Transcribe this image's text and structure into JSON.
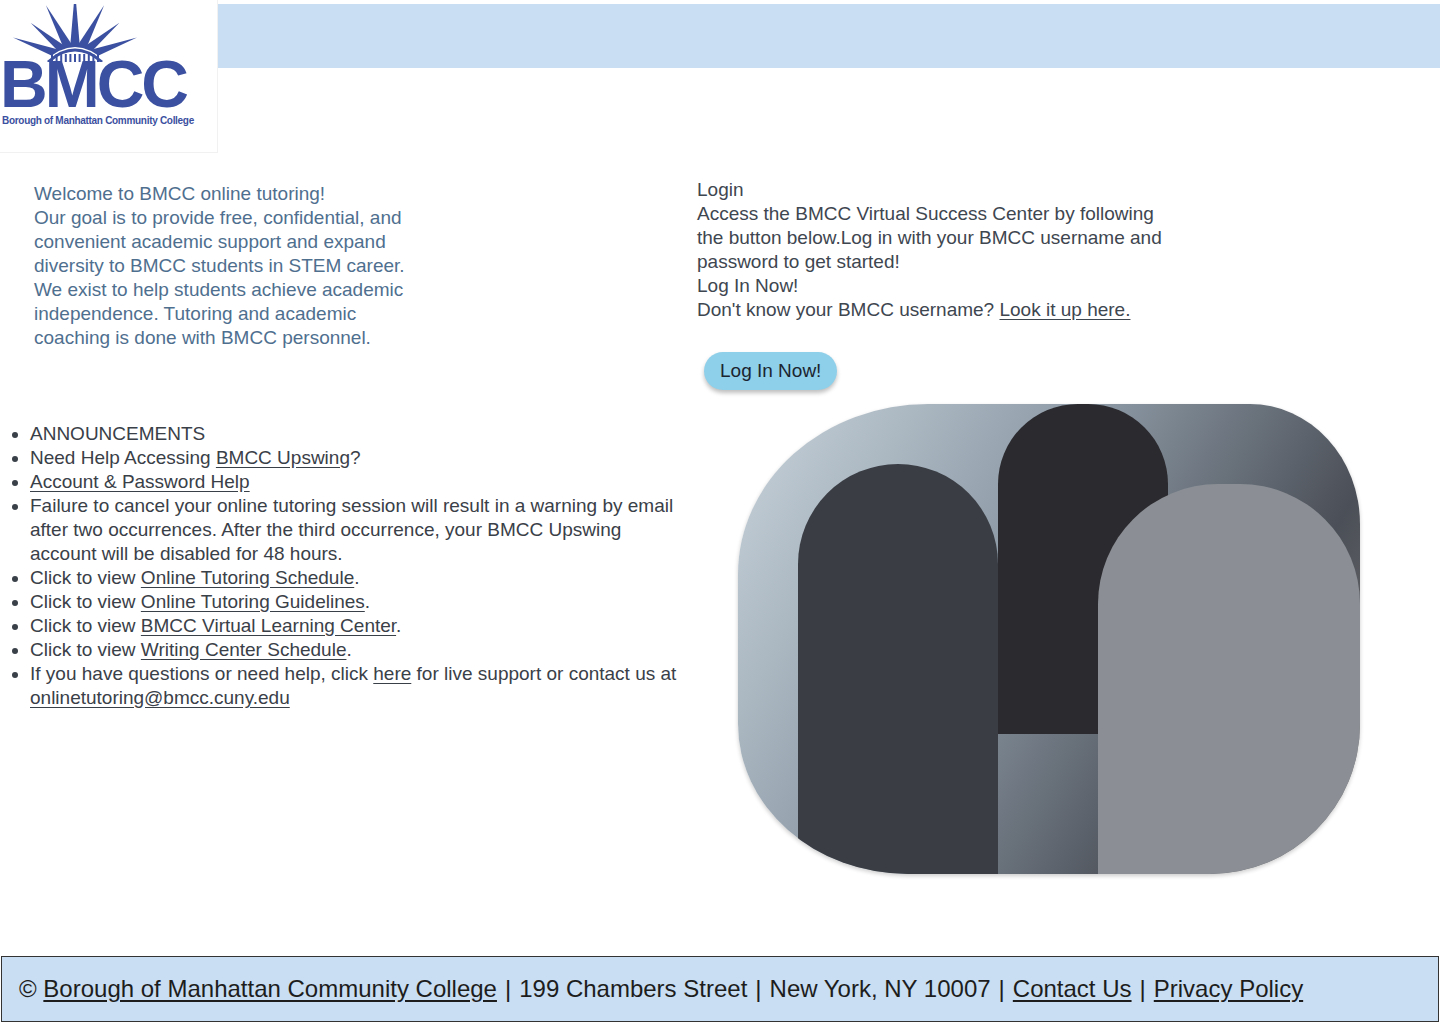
{
  "logo": {
    "letters": "BMCC",
    "subtitle": "Borough of Manhattan Community College"
  },
  "welcome": {
    "lines": [
      "Welcome to BMCC online tutoring!",
      "Our goal is to provide free, confidential, and",
      "convenient academic support and expand",
      "diversity to BMCC students in STEM career.",
      "We exist to help students achieve academic",
      "independence. Tutoring and academic",
      "coaching is done with BMCC personnel."
    ]
  },
  "login": {
    "title": "Login",
    "lines": [
      "Access the BMCC Virtual Success Center by following",
      "the button below.Log in with your BMCC username and",
      "password to get started!"
    ],
    "subtitle": "Log In Now!",
    "username_prompt": "Don't know your BMCC username?",
    "username_link": "Look it up here.",
    "button": "Log In Now!"
  },
  "announcements": [
    {
      "parts": [
        {
          "text": "ANNOUNCEMENTS",
          "link": false
        }
      ]
    },
    {
      "parts": [
        {
          "text": "Need Help Accessing ",
          "link": false
        },
        {
          "text": "BMCC Upswing",
          "link": true
        },
        {
          "text": "?",
          "link": false
        }
      ]
    },
    {
      "parts": [
        {
          "text": "Account & Password Help",
          "link": true
        }
      ]
    },
    {
      "parts": [
        {
          "text": "Failure to cancel your online tutoring session will result in a warning by email after two occurrences. After the third occurrence, your BMCC Upswing account will be disabled for 48 hours.",
          "link": false
        }
      ]
    },
    {
      "parts": [
        {
          "text": "Click to view ",
          "link": false
        },
        {
          "text": "Online Tutoring Schedule",
          "link": true
        },
        {
          "text": ".",
          "link": false
        }
      ]
    },
    {
      "parts": [
        {
          "text": "Click to view ",
          "link": false
        },
        {
          "text": "Online Tutoring Guidelines",
          "link": true
        },
        {
          "text": ".",
          "link": false
        }
      ]
    },
    {
      "parts": [
        {
          "text": "Click to view ",
          "link": false
        },
        {
          "text": "BMCC Virtual Learning Center",
          "link": true
        },
        {
          "text": ".",
          "link": false
        }
      ]
    },
    {
      "parts": [
        {
          "text": "Click to view ",
          "link": false
        },
        {
          "text": "Writing Center Schedule",
          "link": true
        },
        {
          "text": ".",
          "link": false
        }
      ]
    },
    {
      "parts": [
        {
          "text": "If you have questions or need help, click ",
          "link": false
        },
        {
          "text": "here",
          "link": true
        },
        {
          "text": " for live support or contact us at ",
          "link": false
        },
        {
          "text": "onlinetutoring@bmcc.cuny.edu",
          "link": true
        }
      ]
    }
  ],
  "footer": {
    "copyright": "©",
    "separator": "|",
    "parts": [
      {
        "text": "Borough of Manhattan Community College",
        "link": true
      },
      {
        "text": "199 Chambers Street",
        "link": false
      },
      {
        "text": "New York, NY 10007",
        "link": false
      },
      {
        "text": "Contact Us",
        "link": true
      },
      {
        "text": "Privacy Policy",
        "link": true
      }
    ]
  }
}
